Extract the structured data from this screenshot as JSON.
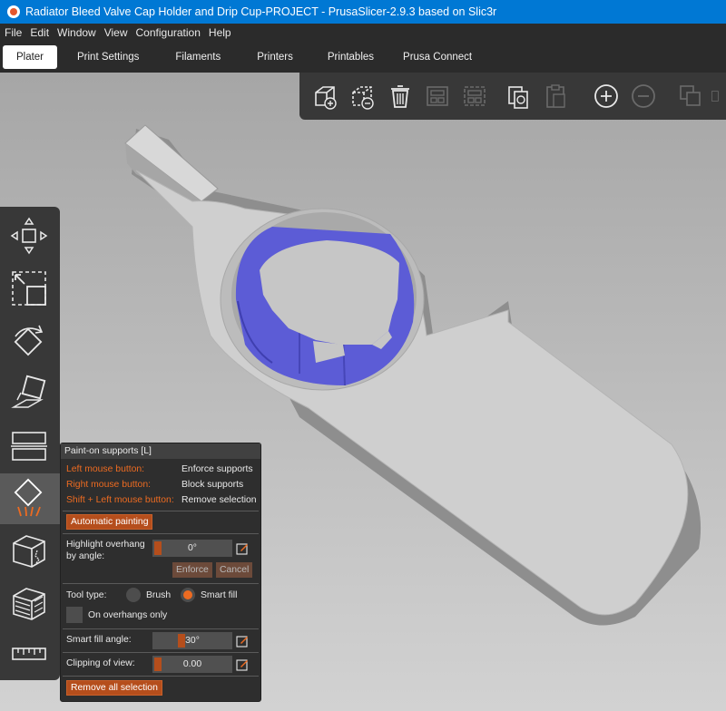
{
  "window": {
    "title": "Radiator Bleed Valve Cap Holder and Drip Cup-PROJECT - PrusaSlicer-2.9.3 based on Slic3r"
  },
  "menu": [
    "File",
    "Edit",
    "Window",
    "View",
    "Configuration",
    "Help"
  ],
  "tabs": [
    "Plater",
    "Print Settings",
    "Filaments",
    "Printers",
    "Printables",
    "Prusa Connect"
  ],
  "top_toolbar": {
    "icons": [
      "add-object-icon",
      "delete-icon",
      "delete-all-icon",
      "arrange-icon",
      "arrange-selection-icon",
      "copy-icon",
      "paste-icon",
      "add-instance-icon",
      "remove-instance-icon",
      "split-objects-icon",
      "split-parts-icon"
    ]
  },
  "left_toolbar": {
    "icons": [
      "move-icon",
      "scale-icon",
      "rotate-icon",
      "place-on-face-icon",
      "cut-icon",
      "paint-supports-icon",
      "seam-painting-icon",
      "multimaterial-painting-icon",
      "measure-icon"
    ],
    "active": "paint-supports-icon"
  },
  "paint_panel": {
    "title": "Paint-on supports [L]",
    "left_mouse_label": "Left mouse button:",
    "left_mouse_value": "Enforce supports",
    "right_mouse_label": "Right mouse button:",
    "right_mouse_value": "Block supports",
    "shift_label": "Shift + Left mouse button:",
    "shift_value": "Remove selection",
    "auto_paint_button": "Automatic painting",
    "highlight_label_1": "Highlight overhang",
    "highlight_label_2": "by angle:",
    "highlight_value": "0°",
    "enforce_button": "Enforce",
    "cancel_button": "Cancel",
    "tool_type_label": "Tool type:",
    "brush_label": "Brush",
    "smart_fill_label": "Smart fill",
    "tool_type_selected": "Smart fill",
    "overhangs_label": "On overhangs only",
    "smart_fill_angle_label": "Smart fill angle:",
    "smart_fill_angle_value": "30°",
    "clipping_label": "Clipping of view:",
    "clipping_value": "0.00",
    "remove_all_button": "Remove all selection"
  },
  "colors": {
    "accent": "#ed6b21",
    "support_paint": "#5a5ad8",
    "model": "#cfcfcf"
  }
}
